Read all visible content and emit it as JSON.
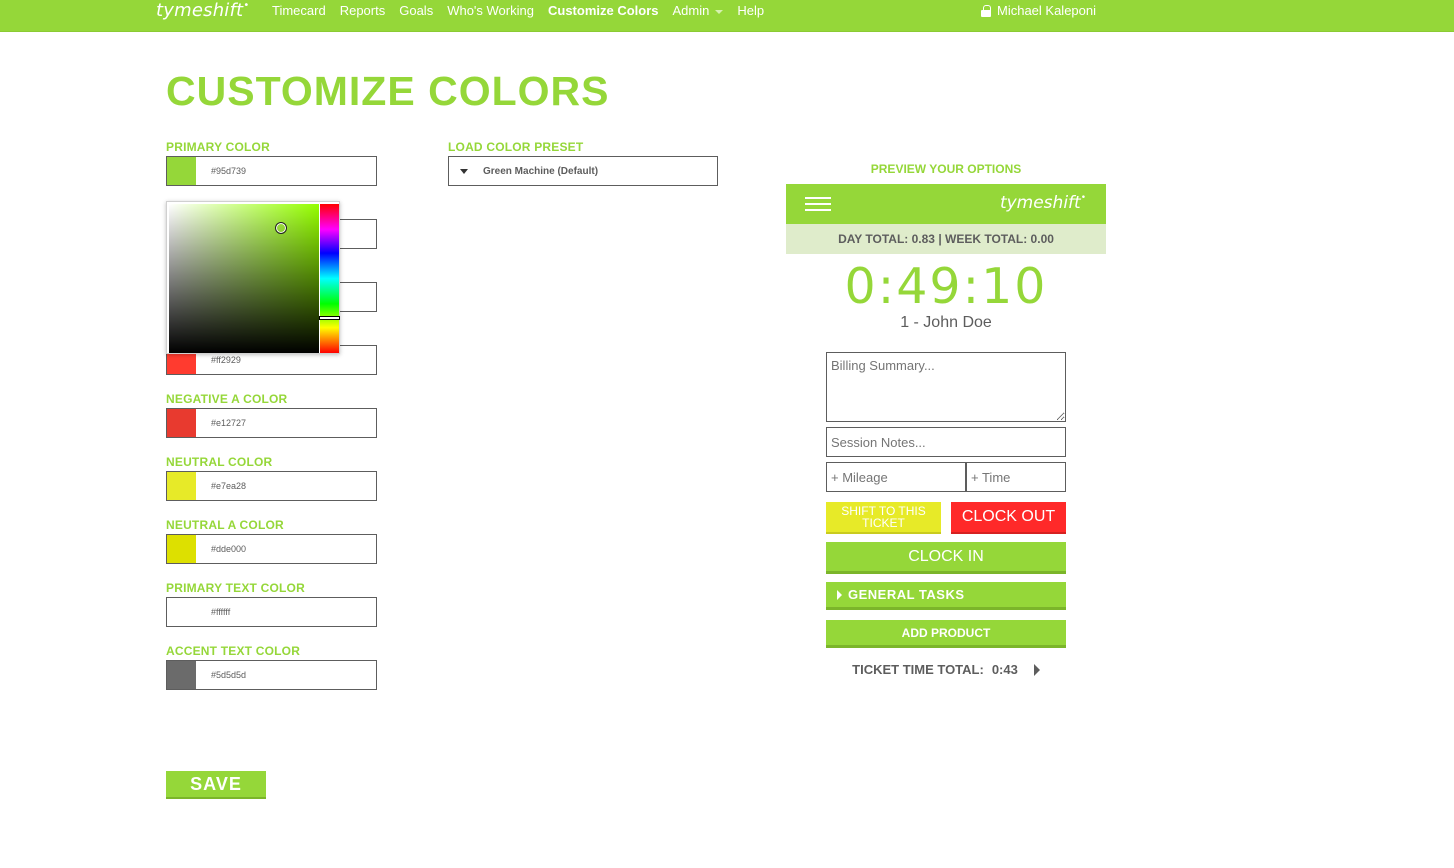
{
  "nav": {
    "logo": "tymeshift",
    "items": [
      "Timecard",
      "Reports",
      "Goals",
      "Who's Working",
      "Customize Colors",
      "Admin",
      "Help"
    ],
    "active": "Customize Colors",
    "user": "Michael Kaleponi"
  },
  "page": {
    "title": "CUSTOMIZE COLORS",
    "save_label": "SAVE"
  },
  "fields": {
    "primary": {
      "label": "PRIMARY COLOR",
      "value": "#95d739",
      "color": "#95d739"
    },
    "accent_hidden": {
      "value": "",
      "color": ""
    },
    "accent2_hidden": {
      "value": "",
      "color": ""
    },
    "negative": {
      "value": "#ff2929",
      "color": "#ff3b2f"
    },
    "negative_a": {
      "label": "NEGATIVE A COLOR",
      "value": "#e12727",
      "color": "#e83a2f"
    },
    "neutral": {
      "label": "NEUTRAL COLOR",
      "value": "#e7ea28",
      "color": "#e7ea28"
    },
    "neutral_a": {
      "label": "NEUTRAL A COLOR",
      "value": "#dde000",
      "color": "#dde000"
    },
    "primary_text": {
      "label": "PRIMARY TEXT COLOR",
      "value": "#ffffff",
      "color": "#ffffff"
    },
    "accent_text": {
      "label": "ACCENT TEXT COLOR",
      "value": "#5d5d5d",
      "color": "#6b6b6b"
    }
  },
  "preset": {
    "label": "LOAD COLOR PRESET",
    "value": "Green Machine (Default)"
  },
  "preview": {
    "title": "PREVIEW YOUR OPTIONS",
    "logo": "tymeshift",
    "totals": "DAY TOTAL: 0.83 | WEEK TOTAL: 0.00",
    "clock": "0:49:10",
    "user": "1 - John Doe",
    "billing_placeholder": "Billing Summary...",
    "notes_placeholder": "Session Notes...",
    "mileage_placeholder": "+ Mileage",
    "time_placeholder": "+ Time",
    "shift_label": "SHIFT TO THIS TICKET",
    "clockout_label": "CLOCK OUT",
    "clockin_label": "CLOCK IN",
    "tasks_label": "GENERAL TASKS",
    "product_label": "ADD PRODUCT",
    "ticket_label": "TICKET TIME TOTAL:",
    "ticket_value": "0:43"
  },
  "icons": [
    "lock-icon",
    "dropdown-triangle-icon",
    "hamburger-menu-icon",
    "expand-triangle-icon",
    "next-triangle-icon"
  ]
}
